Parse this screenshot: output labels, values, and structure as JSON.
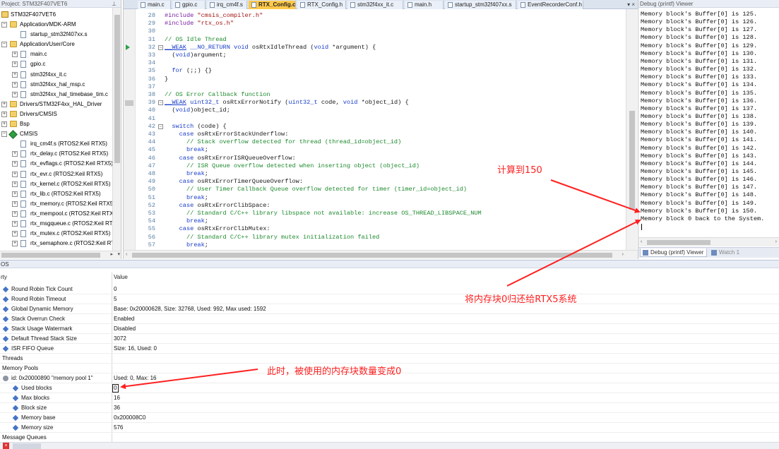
{
  "project": {
    "header": "Project: STM32F407VET6",
    "target": "STM32F407VET6",
    "items": [
      {
        "label": "Application/MDK-ARM",
        "kind": "folder",
        "level": 1,
        "exp": "minus"
      },
      {
        "label": "startup_stm32f407xx.s",
        "kind": "file",
        "level": 2,
        "exp": ""
      },
      {
        "label": "Application/User/Core",
        "kind": "folder",
        "level": 1,
        "exp": "minus"
      },
      {
        "label": "main.c",
        "kind": "file",
        "level": 2,
        "exp": "plus"
      },
      {
        "label": "gpio.c",
        "kind": "file",
        "level": 2,
        "exp": "plus"
      },
      {
        "label": "stm32f4xx_it.c",
        "kind": "file",
        "level": 2,
        "exp": "plus"
      },
      {
        "label": "stm32f4xx_hal_msp.c",
        "kind": "file",
        "level": 2,
        "exp": "plus"
      },
      {
        "label": "stm32f4xx_hal_timebase_tim.c",
        "kind": "file",
        "level": 2,
        "exp": "plus"
      },
      {
        "label": "Drivers/STM32F4xx_HAL_Driver",
        "kind": "folder",
        "level": 1,
        "exp": "plus"
      },
      {
        "label": "Drivers/CMSIS",
        "kind": "folder",
        "level": 1,
        "exp": "plus"
      },
      {
        "label": "Bsp",
        "kind": "folder",
        "level": 1,
        "exp": "plus"
      },
      {
        "label": "CMSIS",
        "kind": "cmsis",
        "level": 1,
        "exp": "minus"
      },
      {
        "label": "irq_cm4f.s (RTOS2:Keil RTX5)",
        "kind": "file",
        "level": 2,
        "exp": ""
      },
      {
        "label": "rtx_delay.c (RTOS2:Keil RTX5)",
        "kind": "file",
        "level": 2,
        "exp": "plus"
      },
      {
        "label": "rtx_evflags.c (RTOS2:Keil RTX5)",
        "kind": "file",
        "level": 2,
        "exp": "plus"
      },
      {
        "label": "rtx_evr.c (RTOS2:Keil RTX5)",
        "kind": "file",
        "level": 2,
        "exp": "plus"
      },
      {
        "label": "rtx_kernel.c (RTOS2:Keil RTX5)",
        "kind": "file",
        "level": 2,
        "exp": "plus"
      },
      {
        "label": "rtx_lib.c (RTOS2:Keil RTX5)",
        "kind": "file",
        "level": 2,
        "exp": "plus"
      },
      {
        "label": "rtx_memory.c (RTOS2:Keil RTX5)",
        "kind": "file",
        "level": 2,
        "exp": "plus"
      },
      {
        "label": "rtx_mempool.c (RTOS2:Keil RTX5)",
        "kind": "file",
        "level": 2,
        "exp": "plus"
      },
      {
        "label": "rtx_msgqueue.c (RTOS2:Keil RTX5)",
        "kind": "file",
        "level": 2,
        "exp": "plus"
      },
      {
        "label": "rtx_mutex.c (RTOS2:Keil RTX5)",
        "kind": "file",
        "level": 2,
        "exp": "plus"
      },
      {
        "label": "rtx_semaphore.c (RTOS2:Keil RTX5)",
        "kind": "file",
        "level": 2,
        "exp": "plus"
      }
    ]
  },
  "editor": {
    "tabs": [
      {
        "label": "main.c",
        "active": false
      },
      {
        "label": "gpio.c",
        "active": false
      },
      {
        "label": "irq_cm4f.s",
        "active": false
      },
      {
        "label": "RTX_Config.c",
        "active": true
      },
      {
        "label": "RTX_Config.h",
        "active": false
      },
      {
        "label": "stm32f4xx_it.c",
        "active": false
      },
      {
        "label": "main.h",
        "active": false
      },
      {
        "label": "startup_stm32f407xx.s",
        "active": false
      },
      {
        "label": "EventRecorderConf.h",
        "active": false
      }
    ],
    "tab_controls": "▾ ×",
    "lines": [
      {
        "n": "28",
        "text": "#include \"cmsis_compiler.h\""
      },
      {
        "n": "29",
        "text": "#include \"rtx_os.h\""
      },
      {
        "n": "30",
        "text": ""
      },
      {
        "n": "31",
        "text": "// OS Idle Thread"
      },
      {
        "n": "32",
        "text": "__WEAK __NO_RETURN void osRtxIdleThread (void *argument) {",
        "fold": "-"
      },
      {
        "n": "33",
        "text": "  (void)argument;"
      },
      {
        "n": "34",
        "text": ""
      },
      {
        "n": "35",
        "text": "  for (;;) {}"
      },
      {
        "n": "36",
        "text": "}"
      },
      {
        "n": "37",
        "text": ""
      },
      {
        "n": "38",
        "text": "// OS Error Callback function"
      },
      {
        "n": "39",
        "text": "__WEAK uint32_t osRtxErrorNotify (uint32_t code, void *object_id) {",
        "fold": "-"
      },
      {
        "n": "40",
        "text": "  (void)object_id;"
      },
      {
        "n": "41",
        "text": ""
      },
      {
        "n": "42",
        "text": "  switch (code) {",
        "fold": "-"
      },
      {
        "n": "43",
        "text": "    case osRtxErrorStackUnderflow:"
      },
      {
        "n": "44",
        "text": "      // Stack overflow detected for thread (thread_id=object_id)"
      },
      {
        "n": "45",
        "text": "      break;"
      },
      {
        "n": "46",
        "text": "    case osRtxErrorISRQueueOverflow:"
      },
      {
        "n": "47",
        "text": "      // ISR Queue overflow detected when inserting object (object_id)"
      },
      {
        "n": "48",
        "text": "      break;"
      },
      {
        "n": "49",
        "text": "    case osRtxErrorTimerQueueOverflow:"
      },
      {
        "n": "50",
        "text": "      // User Timer Callback Queue overflow detected for timer (timer_id=object_id)"
      },
      {
        "n": "51",
        "text": "      break;"
      },
      {
        "n": "52",
        "text": "    case osRtxErrorClibSpace:"
      },
      {
        "n": "53",
        "text": "      // Standard C/C++ library libspace not available: increase OS_THREAD_LIBSPACE_NUM"
      },
      {
        "n": "54",
        "text": "      break;"
      },
      {
        "n": "55",
        "text": "    case osRtxErrorClibMutex:"
      },
      {
        "n": "56",
        "text": "      // Standard C/C++ library mutex initialization failed"
      },
      {
        "n": "57",
        "text": "      break;"
      }
    ]
  },
  "debug": {
    "title": "Debug (printf) Viewer",
    "lines": [
      "Memory block's Buffer[0] is 125.",
      "Memory block's Buffer[0] is 126.",
      "Memory block's Buffer[0] is 127.",
      "Memory block's Buffer[0] is 128.",
      "Memory block's Buffer[0] is 129.",
      "Memory block's Buffer[0] is 130.",
      "Memory block's Buffer[0] is 131.",
      "Memory block's Buffer[0] is 132.",
      "Memory block's Buffer[0] is 133.",
      "Memory block's Buffer[0] is 134.",
      "Memory block's Buffer[0] is 135.",
      "Memory block's Buffer[0] is 136.",
      "Memory block's Buffer[0] is 137.",
      "Memory block's Buffer[0] is 138.",
      "Memory block's Buffer[0] is 139.",
      "Memory block's Buffer[0] is 140.",
      "Memory block's Buffer[0] is 141.",
      "Memory block's Buffer[0] is 142.",
      "Memory block's Buffer[0] is 143.",
      "Memory block's Buffer[0] is 144.",
      "Memory block's Buffer[0] is 145.",
      "Memory block's Buffer[0] is 146.",
      "Memory block's Buffer[0] is 147.",
      "Memory block's Buffer[0] is 148.",
      "Memory block's Buffer[0] is 149.",
      "Memory block's Buffer[0] is 150.",
      "Memory block 0 back to the System."
    ],
    "tabs": [
      {
        "label": "Debug (printf) Viewer",
        "active": true
      },
      {
        "label": "Watch 1",
        "active": false
      }
    ]
  },
  "rtos": {
    "title": "OS",
    "col_property": "rty",
    "col_value": "Value",
    "rows": [
      {
        "name": "Round Robin Tick Count",
        "value": "0",
        "indent": 1,
        "icon": "prop"
      },
      {
        "name": "Round Robin Timeout",
        "value": "5",
        "indent": 1,
        "icon": "prop"
      },
      {
        "name": "Global Dynamic Memory",
        "value": "Base: 0x20000628, Size: 32768, Used: 992, Max used: 1592",
        "indent": 1,
        "icon": "prop"
      },
      {
        "name": "Stack Overrun Check",
        "value": "Enabled",
        "indent": 1,
        "icon": "prop"
      },
      {
        "name": "Stack Usage Watermark",
        "value": "Disabled",
        "indent": 1,
        "icon": "prop"
      },
      {
        "name": "Default Thread Stack Size",
        "value": "3072",
        "indent": 1,
        "icon": "prop"
      },
      {
        "name": "ISR FIFO Queue",
        "value": "Size: 16, Used: 0",
        "indent": 1,
        "icon": "prop"
      },
      {
        "name": "Threads",
        "value": "",
        "indent": 0,
        "icon": ""
      },
      {
        "name": "Memory Pools",
        "value": "",
        "indent": 0,
        "icon": ""
      },
      {
        "name": "id: 0x20000890 \"memory pool 1\"",
        "value": "Used: 0, Max: 16",
        "indent": 1,
        "icon": "gears"
      },
      {
        "name": "Used blocks",
        "value": "0",
        "indent": 2,
        "icon": "prop"
      },
      {
        "name": "Max blocks",
        "value": "16",
        "indent": 2,
        "icon": "prop"
      },
      {
        "name": "Block size",
        "value": "36",
        "indent": 2,
        "icon": "prop"
      },
      {
        "name": "Memory base",
        "value": "0x200008C0",
        "indent": 2,
        "icon": "prop"
      },
      {
        "name": "Memory size",
        "value": "576",
        "indent": 2,
        "icon": "prop"
      },
      {
        "name": "Message Queues",
        "value": "",
        "indent": 0,
        "icon": ""
      }
    ]
  },
  "annotations": {
    "count_to_150": "计算到150",
    "return_block": "将内存块0归还给RTX5系统",
    "used_blocks_zero": "此时，被使用的内存块数量变成0"
  },
  "colors": {
    "annotation": "#ff2020",
    "active_tab": "#ffc94a",
    "comment": "#1e8b2e",
    "keyword": "#1a3ec8",
    "string": "#a31515",
    "line_number": "#5a7fa6"
  }
}
